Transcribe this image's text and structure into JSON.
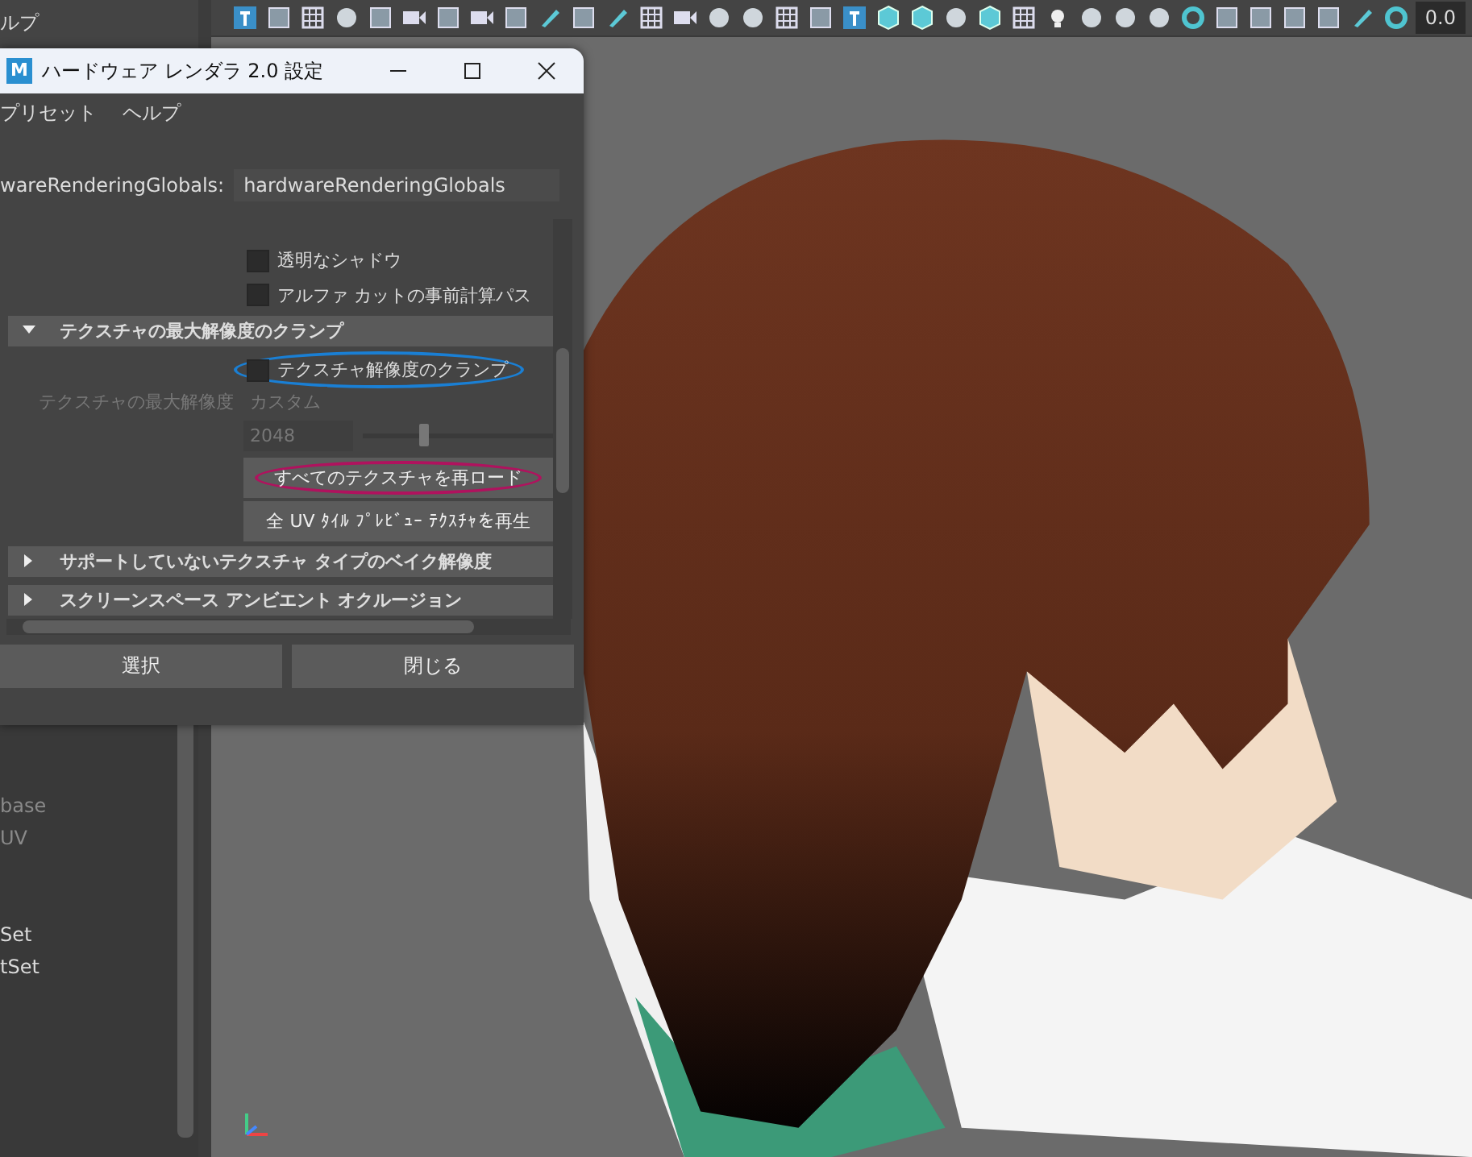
{
  "app_menu": {
    "label": "ルプ"
  },
  "toolbar": {
    "time_field": "0.0"
  },
  "outliner": {
    "items": [
      {
        "label": "base",
        "disabled": true
      },
      {
        "label": "UV",
        "disabled": true
      },
      {
        "label": "Set",
        "disabled": false
      },
      {
        "label": "tSet",
        "disabled": false
      }
    ]
  },
  "dialog": {
    "icon_letter": "M",
    "title": "ハードウェア レンダラ 2.0 設定",
    "menu": [
      "プリセット",
      "ヘルプ"
    ],
    "node_label": "wareRenderingGlobals:",
    "node_value": "hardwareRenderingGlobals",
    "rows": [
      {
        "kind": "checkbox",
        "label": "透明なシャドウ",
        "checked": false
      },
      {
        "kind": "checkbox",
        "label": "アルファ カットの事前計算パス",
        "checked": false
      },
      {
        "kind": "section",
        "label": "テクスチャの最大解像度のクランプ",
        "expanded": true
      },
      {
        "kind": "checkbox",
        "label": "テクスチャ解像度のクランプ",
        "checked": false,
        "color": "#1a7fd4"
      },
      {
        "kind": "dropdown",
        "label": "テクスチャの最大解像度",
        "value": "カスタム",
        "disabled": true
      },
      {
        "kind": "slider",
        "value": "2048",
        "level": 0.3,
        "disabled": true
      },
      {
        "kind": "button",
        "label": "すべてのテクスチャを再ロード",
        "color": "#b0125e"
      },
      {
        "kind": "button",
        "label": "全 UV ﾀｲﾙ ﾌﾟﾚﾋﾞｭｰ ﾃｸｽﾁｬを再生"
      },
      {
        "kind": "section",
        "label": "サポートしていないテクスチャ タイプのベイク解像度",
        "expanded": false
      },
      {
        "kind": "section",
        "label": "スクリーンスペース アンビエント オクルージョン",
        "expanded": false
      }
    ],
    "buttons": [
      "選択",
      "閉じる"
    ]
  }
}
